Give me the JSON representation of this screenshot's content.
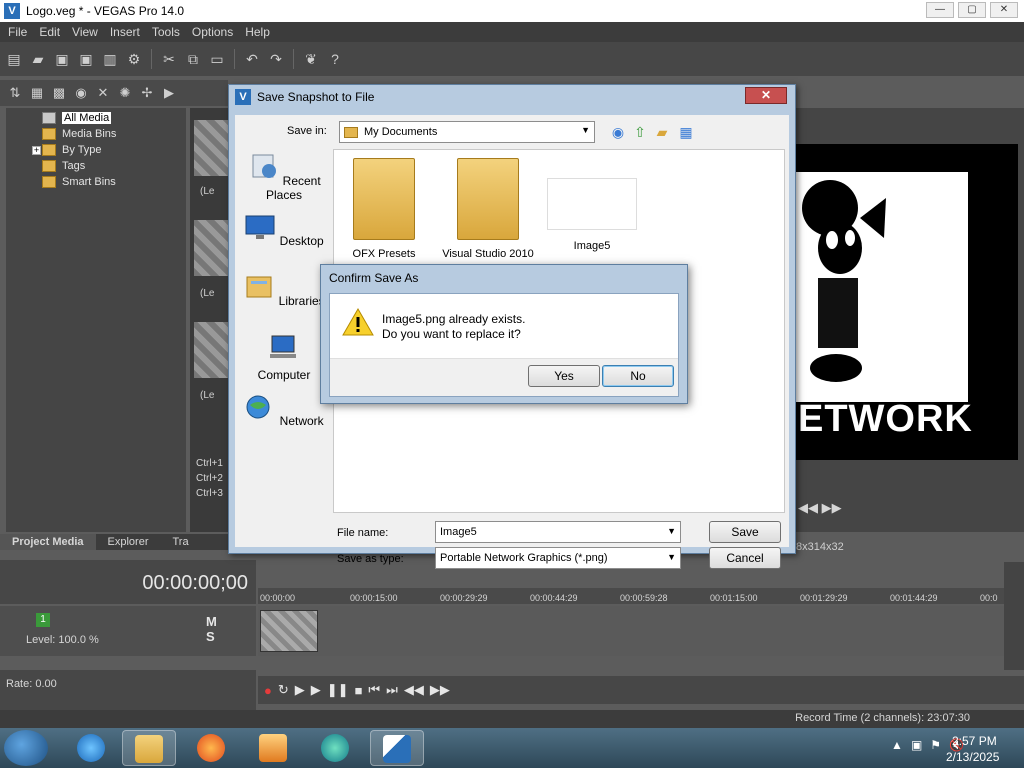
{
  "app": {
    "title": "Logo.veg * - VEGAS Pro 14.0",
    "window_controls": [
      "minimize",
      "maximize",
      "close"
    ]
  },
  "menu": [
    "File",
    "Edit",
    "View",
    "Insert",
    "Tools",
    "Options",
    "Help"
  ],
  "media_tree": {
    "items": [
      {
        "label": "All Media",
        "selected": true
      },
      {
        "label": "Media Bins"
      },
      {
        "label": "By Type",
        "expandable": true
      },
      {
        "label": "Tags"
      },
      {
        "label": "Smart Bins"
      }
    ]
  },
  "media_thumbs": {
    "labels": [
      "(Le",
      "(Le",
      "(Le"
    ],
    "hotkeys": [
      "Ctrl+1",
      "Ctrl+2",
      "Ctrl+3"
    ]
  },
  "bottom_tabs": [
    "Project Media",
    "Explorer",
    "Tra"
  ],
  "preview": {
    "overlay_text": "ETWORK",
    "resolution": "8x314x32"
  },
  "timeline": {
    "timecode": "00:00:00;00",
    "ruler": [
      "00:00:00",
      "00:00:15:00",
      "00:00:29:29",
      "00:00:44:29",
      "00:00:59:28",
      "00:01:15:00",
      "00:01:29:29",
      "00:01:44:29",
      "00:0"
    ],
    "track_number": "1",
    "level": "Level: 100.0 %",
    "rate": "Rate: 0.00",
    "mute_solo": "M S",
    "record_time": "Record Time (2 channels): 23:07:30"
  },
  "save_dialog": {
    "title": "Save Snapshot to File",
    "close_label": "✕",
    "save_in_label": "Save in:",
    "save_in_value": "My Documents",
    "places": [
      "Recent Places",
      "Desktop",
      "Libraries",
      "Computer",
      "Network"
    ],
    "files": [
      "OFX Presets",
      "Visual Studio 2010",
      "Image5"
    ],
    "file_name_label": "File name:",
    "file_name_value": "Image5",
    "save_as_type_label": "Save as type:",
    "save_as_type_value": "Portable Network Graphics (*.png)",
    "save_label": "Save",
    "cancel_label": "Cancel"
  },
  "confirm_dialog": {
    "title": "Confirm Save As",
    "message_line1": "Image5.png already exists.",
    "message_line2": "Do you want to replace it?",
    "yes_label": "Yes",
    "no_label": "No"
  },
  "taskbar": {
    "apps": [
      "internet-explorer",
      "file-explorer",
      "firefox",
      "media-player",
      "edge",
      "vegas-pro"
    ],
    "time": "2:57 PM",
    "date": "2/13/2025"
  }
}
